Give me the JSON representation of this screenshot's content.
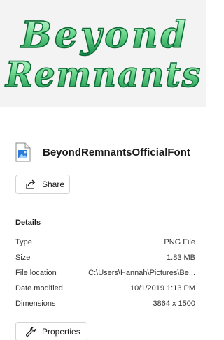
{
  "preview": {
    "line1": "Beyond",
    "line2": "Remnants",
    "colors": {
      "fill_light": "#b7f0c8",
      "fill_dark": "#1e9e56",
      "stroke": "#0e6b38",
      "background": "#f3f3f3"
    }
  },
  "file": {
    "name": "BeyondRemnantsOfficialFont",
    "icon": "image-file-icon"
  },
  "actions": {
    "share_label": "Share",
    "share_icon": "share-icon",
    "properties_label": "Properties",
    "properties_icon": "wrench-icon"
  },
  "details": {
    "title": "Details",
    "rows": [
      {
        "label": "Type",
        "value": "PNG File"
      },
      {
        "label": "Size",
        "value": "1.83 MB"
      },
      {
        "label": "File location",
        "value": "C:\\Users\\Hannah\\Pictures\\Be..."
      },
      {
        "label": "Date modified",
        "value": "10/1/2019 1:13 PM"
      },
      {
        "label": "Dimensions",
        "value": "3864 x 1500"
      }
    ]
  }
}
